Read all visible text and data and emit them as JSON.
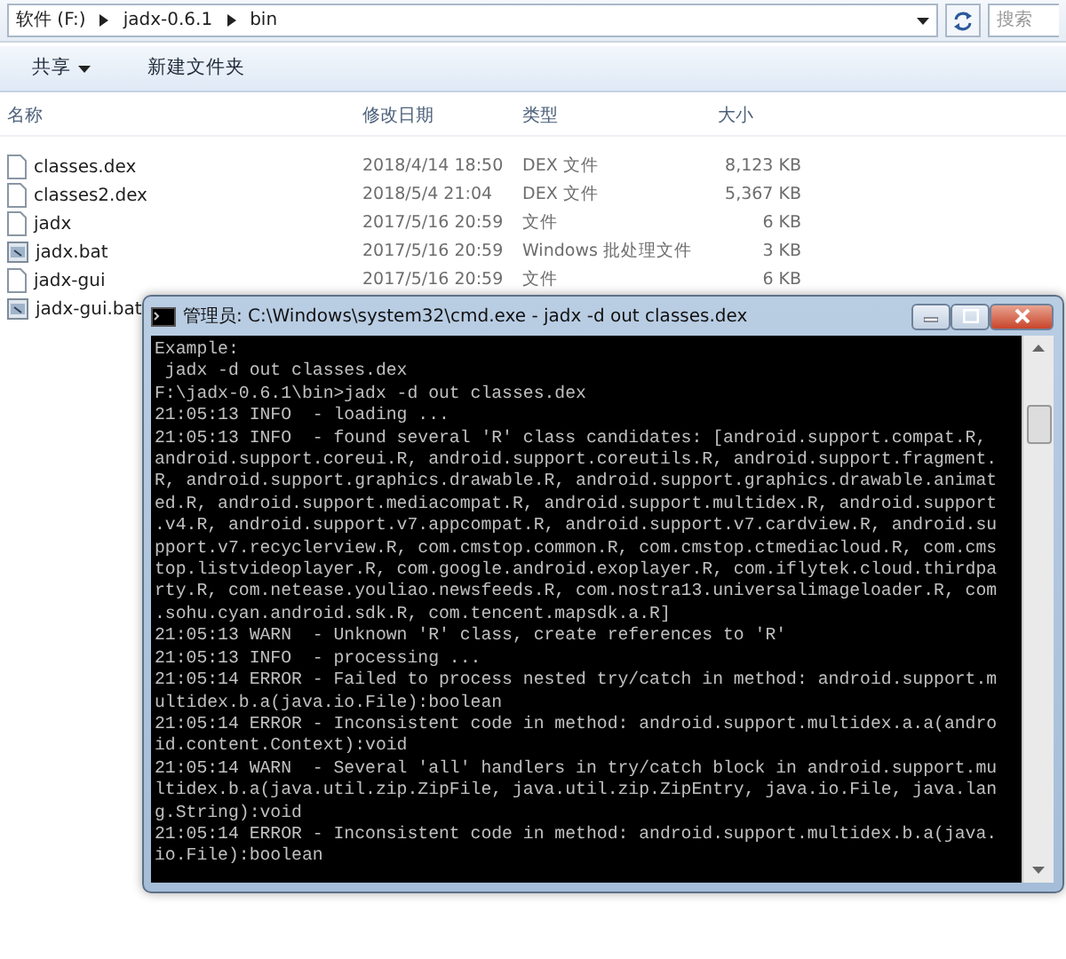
{
  "explorer": {
    "breadcrumb": [
      "软件 (F:)",
      "jadx-0.6.1",
      "bin"
    ],
    "search": {
      "placeholder": "搜索"
    },
    "toolbar": [
      {
        "label": "共享",
        "dropdown": true
      },
      {
        "label": "新建文件夹",
        "dropdown": false
      }
    ],
    "columns": [
      "名称",
      "修改日期",
      "类型",
      "大小"
    ],
    "files": [
      {
        "name": "classes.dex",
        "modified": "2018/4/14 18:50",
        "type": "DEX 文件",
        "size": "8,123 KB",
        "kind": "file"
      },
      {
        "name": "classes2.dex",
        "modified": "2018/5/4 21:04",
        "type": "DEX 文件",
        "size": "5,367 KB",
        "kind": "file"
      },
      {
        "name": "jadx",
        "modified": "2017/5/16 20:59",
        "type": "文件",
        "size": "6 KB",
        "kind": "file"
      },
      {
        "name": "jadx.bat",
        "modified": "2017/5/16 20:59",
        "type": "Windows 批处理文件",
        "size": "3 KB",
        "kind": "batch"
      },
      {
        "name": "jadx-gui",
        "modified": "2017/5/16 20:59",
        "type": "文件",
        "size": "6 KB",
        "kind": "file"
      },
      {
        "name": "jadx-gui.bat",
        "kind": "batch"
      }
    ]
  },
  "console": {
    "title": "管理员: C:\\Windows\\system32\\cmd.exe - jadx  -d out classes.dex",
    "lines": [
      "Example:",
      " jadx -d out classes.dex",
      "F:\\jadx-0.6.1\\bin>jadx -d out classes.dex",
      "21:05:13 INFO  - loading ...",
      "21:05:13 INFO  - found several 'R' class candidates: [android.support.compat.R,",
      "android.support.coreui.R, android.support.coreutils.R, android.support.fragment.",
      "R, android.support.graphics.drawable.R, android.support.graphics.drawable.animat",
      "ed.R, android.support.mediacompat.R, android.support.multidex.R, android.support",
      ".v4.R, android.support.v7.appcompat.R, android.support.v7.cardview.R, android.su",
      "pport.v7.recyclerview.R, com.cmstop.common.R, com.cmstop.ctmediacloud.R, com.cms",
      "top.listvideoplayer.R, com.google.android.exoplayer.R, com.iflytek.cloud.thirdpa",
      "rty.R, com.netease.youliao.newsfeeds.R, com.nostra13.universalimageloader.R, com",
      ".sohu.cyan.android.sdk.R, com.tencent.mapsdk.a.R]",
      "21:05:13 WARN  - Unknown 'R' class, create references to 'R'",
      "21:05:13 INFO  - processing ...",
      "21:05:14 ERROR - Failed to process nested try/catch in method: android.support.m",
      "ultidex.b.a(java.io.File):boolean",
      "21:05:14 ERROR - Inconsistent code in method: android.support.multidex.a.a(andro",
      "id.content.Context):void",
      "21:05:14 WARN  - Several 'all' handlers in try/catch block in android.support.mu",
      "ltidex.b.a(java.util.zip.ZipFile, java.util.zip.ZipEntry, java.io.File, java.lan",
      "g.String):void",
      "21:05:14 ERROR - Inconsistent code in method: android.support.multidex.b.a(java.",
      "io.File):boolean"
    ]
  }
}
